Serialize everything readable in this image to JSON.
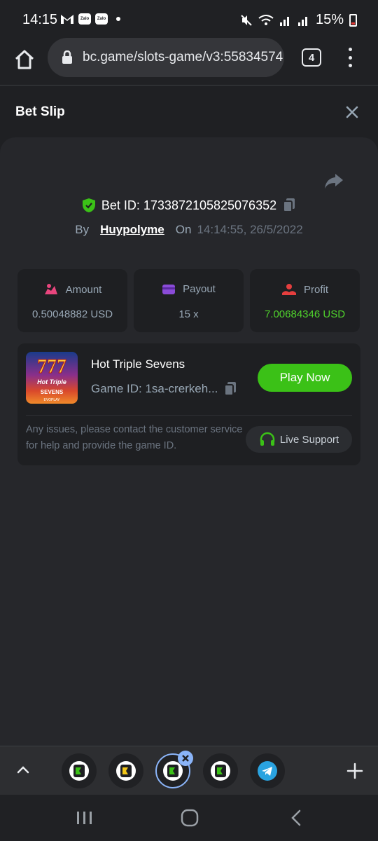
{
  "status_bar": {
    "time": "14:15",
    "battery": "15%",
    "app_icons": [
      "Zalo",
      "Zalo"
    ]
  },
  "browser": {
    "url": "bc.game/slots-game/v3:55834574",
    "tab_count": "4"
  },
  "page": {
    "title": "Bet Slip"
  },
  "bet": {
    "id_label": "Bet ID: 1733872105825076352",
    "by_label": "By",
    "user": "Huypolyme",
    "on_label": "On",
    "datetime": "14:14:55, 26/5/2022"
  },
  "stats": [
    {
      "label": "Amount",
      "value": "0.50048882 USD",
      "icon": "amount-icon",
      "color": "#e8457d"
    },
    {
      "label": "Payout",
      "value": "15 x",
      "icon": "payout-icon",
      "color": "#8a4bd8"
    },
    {
      "label": "Profit",
      "value": "7.00684346 USD",
      "icon": "profit-icon",
      "color": "#e53e3e"
    }
  ],
  "game": {
    "title": "Hot Triple Sevens",
    "id_text": "Game ID: 1sa-crerkeh...",
    "play_label": "Play Now",
    "thumb_text": "Hot Triple Sevens",
    "thumb_brand": "EVOPLAY"
  },
  "support": {
    "issues_text": "Any issues, please contact the customer service for help and provide the game ID.",
    "button_label": "Live Support"
  },
  "colors": {
    "accent_green": "#3bc117",
    "profit_green": "#4fd12c",
    "panel_bg": "#26272b"
  }
}
